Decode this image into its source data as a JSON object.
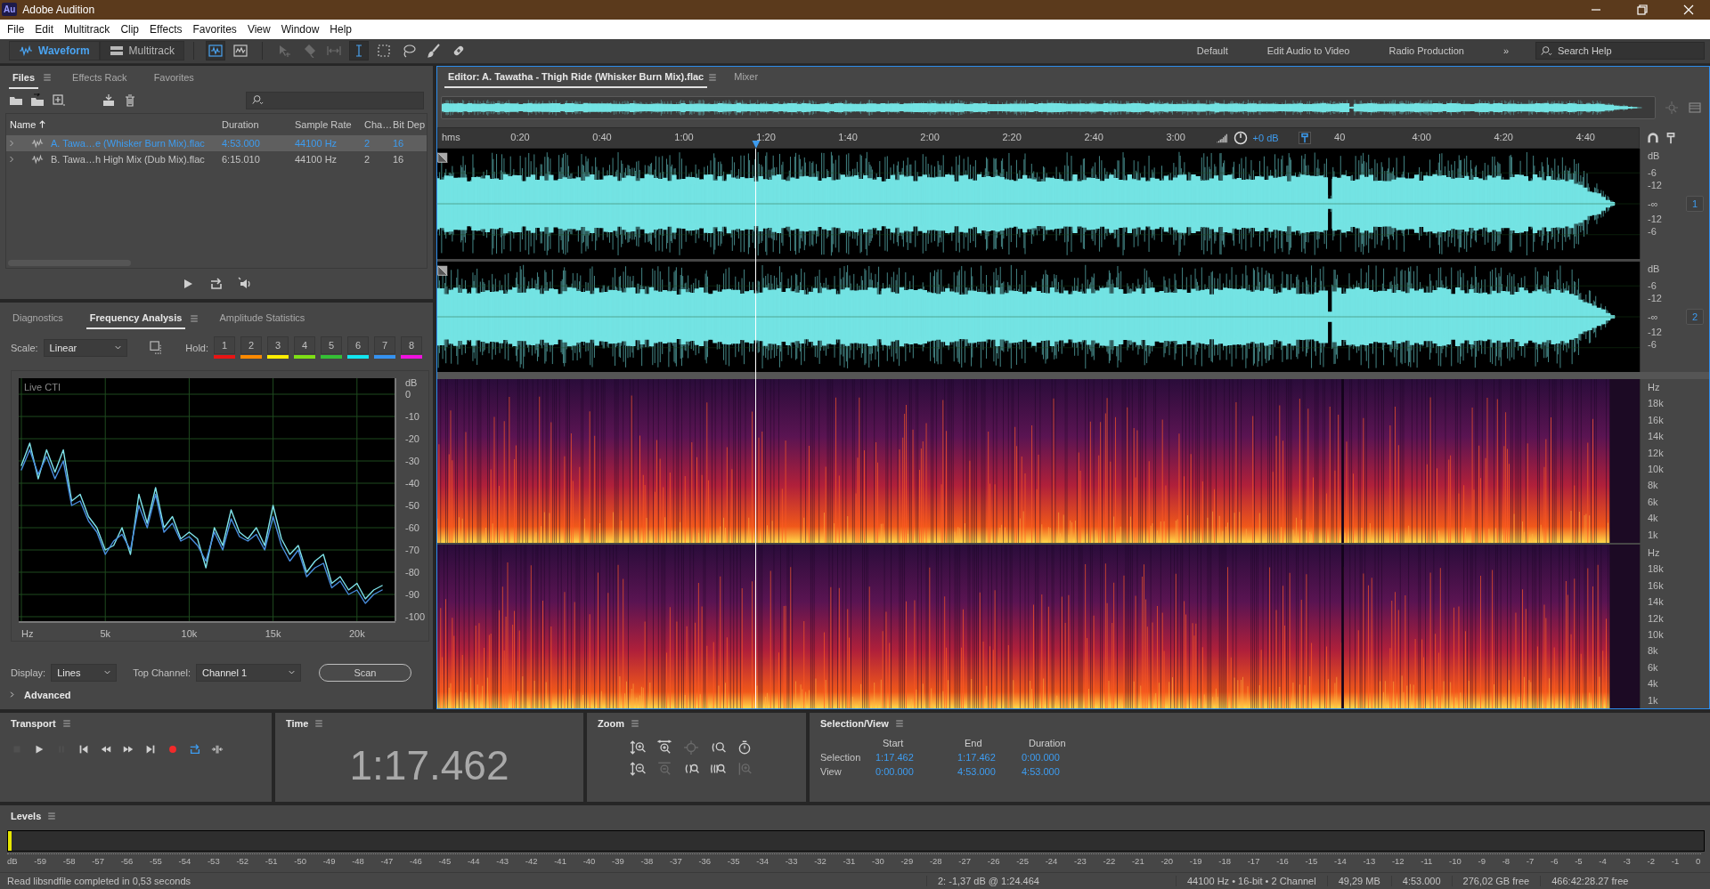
{
  "window": {
    "logo": "Au",
    "title": "Adobe Audition"
  },
  "menu": [
    "File",
    "Edit",
    "Multitrack",
    "Clip",
    "Effects",
    "Favorites",
    "View",
    "Window",
    "Help"
  ],
  "toolbar": {
    "modes": [
      {
        "kind": "waveform",
        "label": "Waveform",
        "selected": true
      },
      {
        "kind": "multitrack",
        "label": "Multitrack",
        "selected": false
      }
    ],
    "tools": [
      {
        "kind": "waveform-view",
        "selected": true,
        "disabled": false
      },
      {
        "kind": "spectrum-view",
        "selected": false,
        "disabled": false
      },
      {
        "kind": "move",
        "selected": false,
        "disabled": true
      },
      {
        "kind": "razor",
        "selected": false,
        "disabled": true
      },
      {
        "kind": "slip",
        "selected": false,
        "disabled": true
      },
      {
        "kind": "time-selection",
        "selected": true,
        "disabled": false
      },
      {
        "kind": "marquee",
        "selected": false,
        "disabled": false
      },
      {
        "kind": "lasso",
        "selected": false,
        "disabled": false
      },
      {
        "kind": "brush",
        "selected": false,
        "disabled": false
      },
      {
        "kind": "healing",
        "selected": false,
        "disabled": false
      }
    ],
    "workspaces": [
      "Default",
      "Edit Audio to Video",
      "Radio Production"
    ],
    "more": "»",
    "search": {
      "placeholder": "Search Help"
    }
  },
  "files_panel": {
    "tabs": [
      {
        "label": "Files",
        "selected": true
      },
      {
        "label": "Effects Rack",
        "selected": false
      },
      {
        "label": "Favorites",
        "selected": false
      }
    ],
    "tools": [
      {
        "kind": "open"
      },
      {
        "kind": "import"
      },
      {
        "kind": "new"
      },
      {
        "kind": "insert"
      },
      {
        "kind": "delete"
      }
    ],
    "columns": [
      {
        "label": "Name",
        "sorted": true
      },
      {
        "label": "Duration",
        "sorted": false
      },
      {
        "label": "Sample Rate",
        "sorted": false
      },
      {
        "label": "Cha…",
        "sorted": false
      },
      {
        "label": "Bit Dep",
        "sorted": false
      }
    ],
    "rows": [
      {
        "name": "A. Tawa…e (Whisker Burn Mix).flac",
        "duration": "4:53.000",
        "sample_rate": "44100 Hz",
        "channels": "2",
        "bit_depth": "16",
        "selected": true
      },
      {
        "name": "B. Tawa…h High Mix (Dub Mix).flac",
        "duration": "6:15.010",
        "sample_rate": "44100 Hz",
        "channels": "2",
        "bit_depth": "16",
        "selected": false
      }
    ],
    "player": [
      {
        "kind": "play"
      },
      {
        "kind": "loop"
      },
      {
        "kind": "autoplay"
      }
    ]
  },
  "freq_panel": {
    "tabs": [
      {
        "label": "Diagnostics",
        "selected": false
      },
      {
        "label": "Frequency Analysis",
        "selected": true
      },
      {
        "label": "Amplitude Statistics",
        "selected": false
      }
    ],
    "scale": {
      "label": "Scale:",
      "value": "Linear"
    },
    "hold": {
      "label": "Hold:",
      "buttons": [
        {
          "label": "1",
          "color": "#e81414"
        },
        {
          "label": "2",
          "color": "#ff8a00"
        },
        {
          "label": "3",
          "color": "#ffee00"
        },
        {
          "label": "4",
          "color": "#7ee015"
        },
        {
          "label": "5",
          "color": "#35c035"
        },
        {
          "label": "6",
          "color": "#12e6f0"
        },
        {
          "label": "7",
          "color": "#3592f0"
        },
        {
          "label": "8",
          "color": "#f012e0"
        }
      ]
    },
    "chart_data": {
      "type": "line",
      "title": "Live CTI",
      "ylabel": "dB",
      "xlim": [
        -160,
        22240
      ],
      "ylim": [
        -102,
        7.2
      ],
      "grid": true,
      "x": [
        0,
        500,
        1000,
        1500,
        2000,
        2500,
        3000,
        3500,
        4000,
        4500,
        5000,
        5500,
        6000,
        6500,
        7000,
        7500,
        8000,
        8500,
        9000,
        9500,
        10000,
        10500,
        11000,
        11500,
        12000,
        12500,
        13000,
        13500,
        14000,
        14500,
        15000,
        15500,
        16000,
        16500,
        17000,
        17500,
        18000,
        18500,
        19000,
        19500,
        20000,
        20500,
        21000,
        21500
      ],
      "series": [
        {
          "color": "#7fe3ea",
          "values": [
            -32,
            -22,
            -38,
            -25,
            -35,
            -25,
            -48,
            -45,
            -55,
            -60,
            -70,
            -68,
            -60,
            -72,
            -45,
            -58,
            -42,
            -60,
            -55,
            -65,
            -62,
            -65,
            -78,
            -60,
            -68,
            -52,
            -62,
            -65,
            -60,
            -68,
            -50,
            -65,
            -72,
            -68,
            -80,
            -75,
            -72,
            -85,
            -82,
            -88,
            -85,
            -92,
            -88,
            -86
          ]
        },
        {
          "color": "#4a8fe0",
          "values": [
            -34,
            -25,
            -36,
            -28,
            -38,
            -30,
            -50,
            -48,
            -57,
            -62,
            -72,
            -66,
            -63,
            -70,
            -50,
            -60,
            -45,
            -62,
            -58,
            -66,
            -64,
            -68,
            -75,
            -62,
            -70,
            -56,
            -64,
            -66,
            -63,
            -70,
            -55,
            -68,
            -75,
            -70,
            -82,
            -78,
            -76,
            -87,
            -84,
            -90,
            -88,
            -94,
            -90,
            -88
          ]
        }
      ],
      "xticks": [
        {
          "value": 0,
          "label": "Hz"
        },
        {
          "value": 5000,
          "label": "5k"
        },
        {
          "value": 10000,
          "label": "10k"
        },
        {
          "value": 15000,
          "label": "15k"
        },
        {
          "value": 20000,
          "label": "20k"
        }
      ],
      "yticks": [
        0,
        -10,
        -20,
        -30,
        -40,
        -50,
        -60,
        -70,
        -80,
        -90,
        -100
      ]
    },
    "display": {
      "label": "Display:",
      "value": "Lines"
    },
    "top_channel": {
      "label": "Top Channel:",
      "value": "Channel 1"
    },
    "scan": "Scan",
    "advanced": {
      "label": "Advanced",
      "expanded": false
    }
  },
  "editor": {
    "tabs": [
      {
        "label": "Editor: A. Tawatha - Thigh Ride (Whisker Burn Mix).flac",
        "selected": true
      },
      {
        "label": "Mixer",
        "selected": false
      }
    ],
    "ruler": {
      "unit": "hms",
      "ticks": [
        "0:20",
        "0:40",
        "1:00",
        "1:20",
        "1:40",
        "2:00",
        "2:20",
        "2:40",
        "3:00",
        "40",
        "4:00",
        "4:20",
        "4:40"
      ]
    },
    "hud": {
      "gain": "+0 dB"
    },
    "playhead": {
      "level": 0.2644
    },
    "channels": [
      {
        "badge": "1",
        "scale": [
          "dB",
          "-6",
          "-12",
          "-∞",
          "-12",
          "-6"
        ]
      },
      {
        "badge": "2",
        "scale": [
          "dB",
          "-6",
          "-12",
          "-∞",
          "-12",
          "-6"
        ]
      }
    ],
    "spectral": [
      {
        "scale": [
          "Hz",
          "18k",
          "16k",
          "14k",
          "12k",
          "10k",
          "8k",
          "6k",
          "4k",
          "1k"
        ]
      },
      {
        "scale": [
          "Hz",
          "18k",
          "16k",
          "14k",
          "12k",
          "10k",
          "8k",
          "6k",
          "4k",
          "1k"
        ]
      }
    ]
  },
  "transport": {
    "title": "Transport",
    "buttons": [
      {
        "kind": "stop",
        "disabled": true,
        "on": false
      },
      {
        "kind": "play",
        "disabled": false,
        "on": false
      },
      {
        "kind": "pause",
        "disabled": true,
        "on": false
      },
      {
        "kind": "to-start",
        "disabled": false,
        "on": false
      },
      {
        "kind": "rewind",
        "disabled": false,
        "on": false
      },
      {
        "kind": "forward",
        "disabled": false,
        "on": false
      },
      {
        "kind": "to-end",
        "disabled": false,
        "on": false
      },
      {
        "kind": "record",
        "disabled": false,
        "on": false
      },
      {
        "kind": "loop",
        "disabled": false,
        "on": true
      },
      {
        "kind": "skip",
        "disabled": false,
        "on": false
      }
    ]
  },
  "time": {
    "title": "Time",
    "value": "1:17.462"
  },
  "zoom": {
    "title": "Zoom",
    "buttons": [
      {
        "kind": "in-amp",
        "disabled": false
      },
      {
        "kind": "in-time",
        "disabled": false
      },
      {
        "kind": "selection",
        "disabled": true
      },
      {
        "kind": "in-left",
        "disabled": false
      },
      {
        "kind": "reset",
        "disabled": false
      },
      {
        "kind": "out-amp",
        "disabled": false
      },
      {
        "kind": "out-time",
        "disabled": true
      },
      {
        "kind": "out-left",
        "disabled": false
      },
      {
        "kind": "out-full",
        "disabled": false
      },
      {
        "kind": "full",
        "disabled": true
      }
    ]
  },
  "selection_view": {
    "title": "Selection/View",
    "columns": [
      "Start",
      "End",
      "Duration"
    ],
    "rows": [
      {
        "label": "Selection",
        "values": [
          "1:17.462",
          "1:17.462",
          "0:00.000"
        ]
      },
      {
        "label": "View",
        "values": [
          "0:00.000",
          "4:53.000",
          "4:53.000"
        ]
      }
    ]
  },
  "levels": {
    "title": "Levels",
    "level": 0.002,
    "ticks": [
      "dB",
      "-59",
      "-58",
      "-57",
      "-56",
      "-55",
      "-54",
      "-53",
      "-52",
      "-51",
      "-50",
      "-49",
      "-48",
      "-47",
      "-46",
      "-45",
      "-44",
      "-43",
      "-42",
      "-41",
      "-40",
      "-39",
      "-38",
      "-37",
      "-36",
      "-35",
      "-34",
      "-33",
      "-32",
      "-31",
      "-30",
      "-29",
      "-28",
      "-27",
      "-26",
      "-25",
      "-24",
      "-23",
      "-22",
      "-21",
      "-20",
      "-19",
      "-18",
      "-17",
      "-16",
      "-15",
      "-14",
      "-13",
      "-12",
      "-11",
      "-10",
      "-9",
      "-8",
      "-7",
      "-6",
      "-5",
      "-4",
      "-3",
      "-2",
      "-1",
      "0"
    ]
  },
  "status_bar": {
    "message": "Read libsndfile completed in 0,53 seconds",
    "cursor": "2: -1,37 dB @ 1:24.464",
    "format": "44100 Hz • 16-bit • 2 Channel",
    "size": "49,29 MB",
    "duration": "4:53.000",
    "disk": "276,02 GB free",
    "time_free": "466:42:28.27 free"
  }
}
